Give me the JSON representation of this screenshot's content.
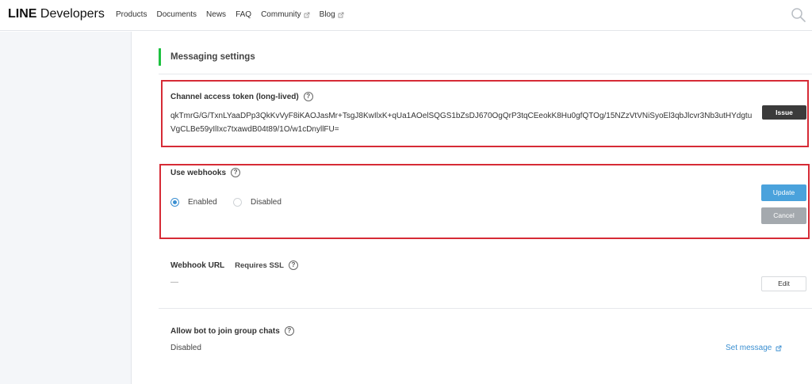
{
  "header": {
    "brand_line": "LINE",
    "brand_name": "Developers",
    "nav": [
      {
        "label": "Products",
        "external": false
      },
      {
        "label": "Documents",
        "external": false
      },
      {
        "label": "News",
        "external": false
      },
      {
        "label": "FAQ",
        "external": false
      },
      {
        "label": "Community",
        "external": true
      },
      {
        "label": "Blog",
        "external": true
      }
    ],
    "search_icon": "search-icon"
  },
  "section": {
    "title": "Messaging settings"
  },
  "token": {
    "label": "Channel access token (long-lived)",
    "value": "qkTmrG/G/TxnLYaaDPp3QkKvVyF8iKAOJasMr+TsgJ8KwIlxK+qUa1AOelSQGS1bZsDJ670OgQrP3tqCEeokK8Hu0gfQTOg/15NZzVtVNiSyoEl3qbJlcvr3Nb3utHYdgtuVgCLBe59yIlIxc7txawdB04t89/1O/w1cDnyllFU=",
    "issue_label": "Issue"
  },
  "webhooks": {
    "label": "Use webhooks",
    "options": [
      {
        "label": "Enabled",
        "checked": true
      },
      {
        "label": "Disabled",
        "checked": false
      }
    ],
    "update_label": "Update",
    "cancel_label": "Cancel"
  },
  "webhook_url": {
    "label": "Webhook URL",
    "sublabel": "Requires SSL",
    "value": "—",
    "edit_label": "Edit"
  },
  "group_chats": {
    "label": "Allow bot to join group chats",
    "value": "Disabled",
    "link_label": "Set message"
  },
  "colors": {
    "accent_green": "#1dc140",
    "highlight_red": "#d62b36",
    "primary_blue": "#4aa2dc",
    "issue_dark": "#3b3b3b",
    "cancel_gray": "#a4a9ae"
  }
}
